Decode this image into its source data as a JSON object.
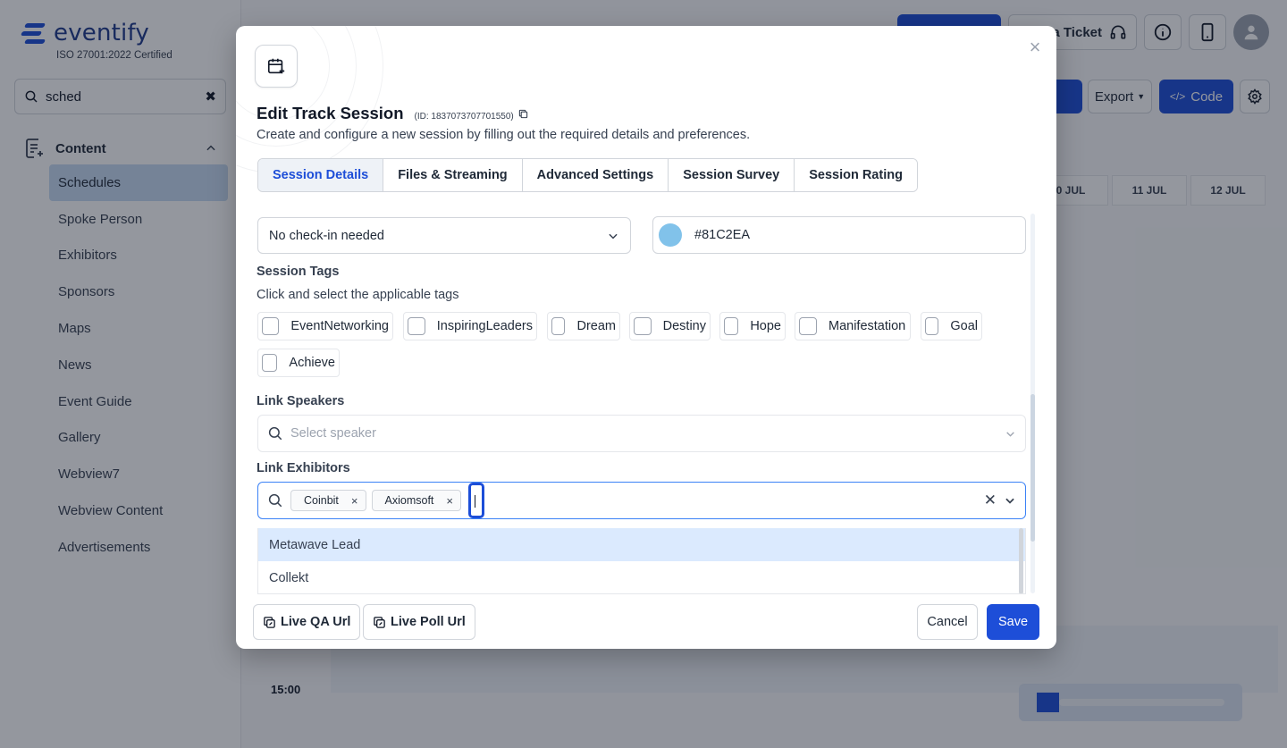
{
  "app": {
    "brand": "eventify",
    "certification": "ISO 27001:2022 Certified",
    "search_value": "sched",
    "group_label": "Content",
    "nav_items": [
      "Schedules",
      "Spoke Person",
      "Exhibitors",
      "Sponsors",
      "Maps",
      "News",
      "Event Guide",
      "Gallery",
      "Webview7",
      "Webview Content",
      "Advertisements"
    ],
    "active_nav": "Schedules",
    "topbar": {
      "ticket_label": "a Ticket",
      "export_label": "Export",
      "code_label": "Code"
    },
    "calendar": {
      "days": [
        "0 JUL",
        "11 JUL",
        "12 JUL"
      ],
      "time_label": "15:00"
    }
  },
  "modal": {
    "title": "Edit Track Session",
    "id_label": "(ID: 1837073707701550)",
    "subtitle": "Create and configure a new session by filling out the required details and preferences.",
    "tabs": [
      "Session Details",
      "Files & Streaming",
      "Advanced Settings",
      "Session Survey",
      "Session Rating"
    ],
    "active_tab": "Session Details",
    "checkin_value": "No check-in needed",
    "color_value": "#81C2EA",
    "session_tags_label": "Session Tags",
    "session_tags_hint": "Click and select the applicable tags",
    "tags": [
      "EventNetworking",
      "InspiringLeaders",
      "Dream",
      "Destiny",
      "Hope",
      "Manifestation",
      "Goal",
      "Achieve"
    ],
    "link_speakers_label": "Link Speakers",
    "speaker_placeholder": "Select speaker",
    "link_exhibitors_label": "Link Exhibitors",
    "selected_exhibitors": [
      "Coinbit",
      "Axiomsoft"
    ],
    "exhibitor_options": [
      "Metawave Lead",
      "Collekt"
    ],
    "footer": {
      "live_qa": "Live QA Url",
      "live_poll": "Live Poll Url",
      "cancel": "Cancel",
      "save": "Save"
    }
  },
  "colors": {
    "accent": "#1d4ed8",
    "swatch": "#81C2EA",
    "highlight": "#dbeafe"
  }
}
